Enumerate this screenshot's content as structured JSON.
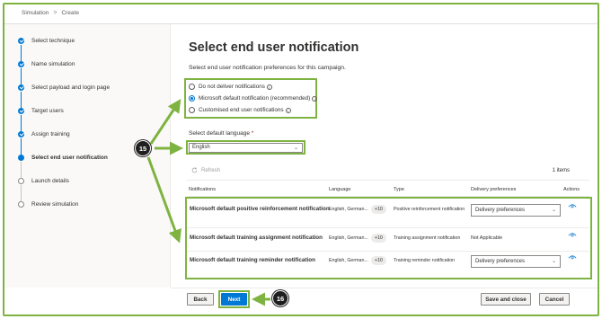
{
  "breadcrumb": {
    "root": "Simulation",
    "current": "Create"
  },
  "steps": [
    {
      "label": "Select technique",
      "state": "done"
    },
    {
      "label": "Name simulation",
      "state": "done"
    },
    {
      "label": "Select payload and login page",
      "state": "done"
    },
    {
      "label": "Target users",
      "state": "done"
    },
    {
      "label": "Assign training",
      "state": "done"
    },
    {
      "label": "Select end user notification",
      "state": "current"
    },
    {
      "label": "Launch details",
      "state": "todo"
    },
    {
      "label": "Review simulation",
      "state": "todo"
    }
  ],
  "main": {
    "title": "Select end user notification",
    "subtitle": "Select end user notification preferences for this campaign.",
    "options": [
      {
        "label": "Do not deliver notifications",
        "selected": false
      },
      {
        "label": "Microsoft default notification (recommended)",
        "selected": true
      },
      {
        "label": "Customised end user notifications",
        "selected": false
      }
    ],
    "language_label": "Select default language",
    "language_required": "*",
    "language_value": "English",
    "refresh_label": "Refresh",
    "item_count": "1 items"
  },
  "table": {
    "headers": [
      "Notifications",
      "Language",
      "Type",
      "Delivery preferences",
      "Actions"
    ],
    "rows": [
      {
        "name": "Microsoft default positive reinforcement notification",
        "language": "English, German...",
        "more": "+10",
        "type": "Positive reinforcement notification",
        "delivery": "Delivery preferences"
      },
      {
        "name": "Microsoft default training assignment notification",
        "language": "English, German...",
        "more": "+10",
        "type": "Training assignment notification",
        "delivery": "Not Applicable"
      },
      {
        "name": "Microsoft default training reminder notification",
        "language": "English, German...",
        "more": "+10",
        "type": "Training reminder notification",
        "delivery": "Delivery preferences"
      }
    ]
  },
  "footer": {
    "back": "Back",
    "next": "Next",
    "save_close": "Save and close",
    "cancel": "Cancel"
  },
  "callouts": {
    "first": "15",
    "second": "16"
  },
  "colors": {
    "accent": "#0078d4",
    "highlight": "#7fb341",
    "callout": "#1f1f1f"
  }
}
